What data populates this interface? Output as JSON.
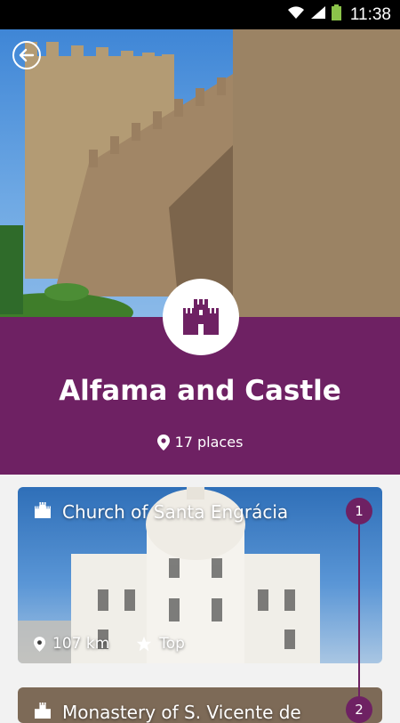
{
  "status_bar": {
    "time": "11:38"
  },
  "header": {
    "back_icon": "arrow-left-circle-icon",
    "badge_icon": "castle-icon"
  },
  "area": {
    "title": "Alfama and Castle",
    "places_count": "17 places"
  },
  "places": [
    {
      "number": "1",
      "name": "Church of Santa Engrácia",
      "distance": "107 km",
      "tag": "Top"
    },
    {
      "number": "2",
      "name": "Monastery of S. Vicente de"
    }
  ],
  "colors": {
    "accent": "#6e2163",
    "status_bar": "#000000",
    "battery": "#8bc34a"
  }
}
